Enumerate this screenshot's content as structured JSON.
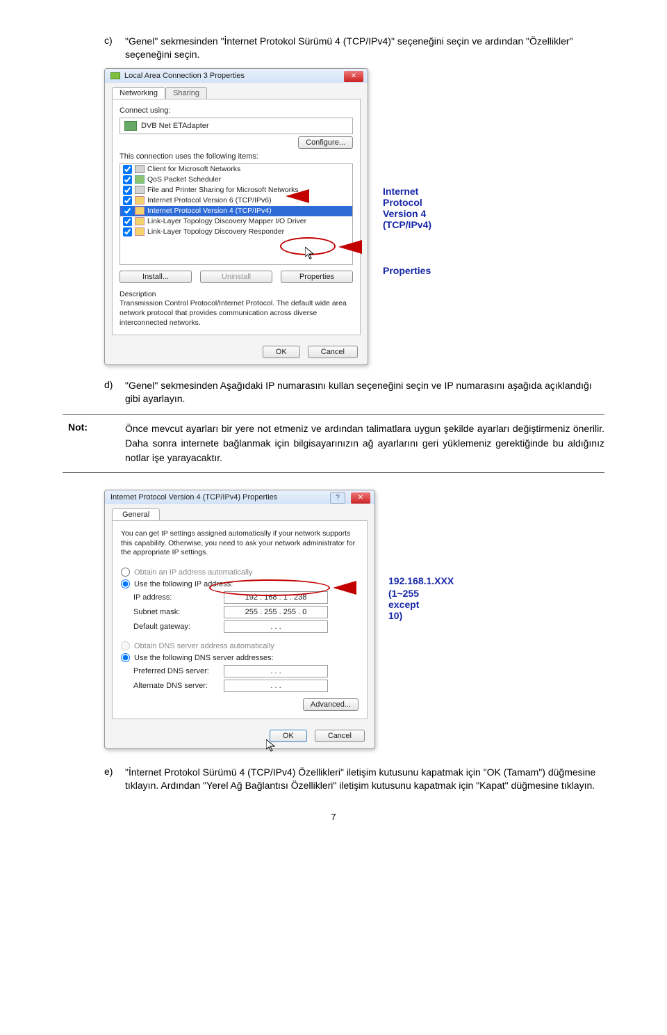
{
  "stepC": {
    "letter": "c)",
    "text": "\"Genel\" sekmesinden \"İnternet Protokol Sürümü 4 (TCP/IPv4)\" seçeneğini seçin ve ardından \"Özellikler\" seçeneğini seçin."
  },
  "dlg1": {
    "title": "Local Area Connection 3 Properties",
    "tabNetworking": "Networking",
    "tabSharing": "Sharing",
    "connectUsing": "Connect using:",
    "adapter": "DVB Net ETAdapter",
    "configure": "Configure...",
    "itemsLabel": "This connection uses the following items:",
    "items": [
      "Client for Microsoft Networks",
      "QoS Packet Scheduler",
      "File and Printer Sharing for Microsoft Networks",
      "Internet Protocol Version 6 (TCP/IPv6)",
      "Internet Protocol Version 4 (TCP/IPv4)",
      "Link-Layer Topology Discovery Mapper I/O Driver",
      "Link-Layer Topology Discovery Responder"
    ],
    "install": "Install...",
    "uninstall": "Uninstall",
    "properties": "Properties",
    "descLabel": "Description",
    "descText": "Transmission Control Protocol/Internet Protocol. The default wide area network protocol that provides communication across diverse interconnected networks.",
    "ok": "OK",
    "cancel": "Cancel"
  },
  "callout1a": "Internet Protocol Version 4 (TCP/IPv4)",
  "callout1b": "Properties",
  "stepD": {
    "letter": "d)",
    "text": "\"Genel\" sekmesinden Aşağıdaki IP numarasını kullan seçeneğini seçin ve IP numarasını aşağıda açıklandığı gibi ayarlayın."
  },
  "note": {
    "label": "Not:",
    "text": "Önce mevcut ayarları bir yere not etmeniz ve ardından talimatlara uygun şekilde ayarları değiştirmeniz önerilir. Daha sonra internete bağlanmak için bilgisayarınızın ağ ayarlarını geri yüklemeniz gerektiğinde bu aldığınız notlar işe yarayacaktır."
  },
  "dlg2": {
    "title": "Internet Protocol Version 4 (TCP/IPv4) Properties",
    "tabGeneral": "General",
    "intro": "You can get IP settings assigned automatically if your network supports this capability. Otherwise, you need to ask your network administrator for the appropriate IP settings.",
    "obtainIp": "Obtain an IP address automatically",
    "useIp": "Use the following IP address:",
    "ipLabel": "IP address:",
    "ipVal": "192 . 168 .   1  . 238",
    "subnetLabel": "Subnet mask:",
    "subnetVal": "255 . 255 . 255 .   0",
    "gwLabel": "Default gateway:",
    "gwVal": " .     .     . ",
    "obtainDns": "Obtain DNS server address automatically",
    "useDns": "Use the following DNS server addresses:",
    "prefDns": "Preferred DNS server:",
    "altDns": "Alternate DNS server:",
    "dnsVal": " .     .     . ",
    "advanced": "Advanced...",
    "ok": "OK",
    "cancel": "Cancel"
  },
  "callout2a": "192.168.1.XXX",
  "callout2b": "(1~255 except 10)",
  "stepE": {
    "letter": "e)",
    "text": "\"İnternet Protokol Sürümü 4 (TCP/IPv4) Özellikleri\" iletişim kutusunu kapatmak için \"OK (Tamam\") düğmesine tıklayın. Ardından \"Yerel Ağ Bağlantısı Özellikleri\" iletişim kutusunu kapatmak için \"Kapat\" düğmesine tıklayın."
  },
  "pageNumber": "7"
}
